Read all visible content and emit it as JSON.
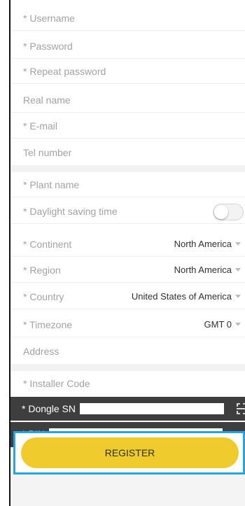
{
  "form": {
    "username": "* Username",
    "password": "* Password",
    "repeat_password": "* Repeat password",
    "real_name": "Real name",
    "email": "* E-mail",
    "tel_number": "Tel number",
    "plant_name": "* Plant name",
    "daylight_saving": "* Daylight saving time",
    "daylight_saving_on": false,
    "continent_label": "* Continent",
    "continent_value": "North America",
    "region_label": "* Region",
    "region_value": "North America",
    "country_label": "* Country",
    "country_value": "United States of America",
    "timezone_label": "* Timezone",
    "timezone_value": "GMT 0",
    "address": "Address",
    "installer_code": "* Installer Code",
    "dongle_sn_label": "* Dongle SN",
    "pin_label": "* PIN"
  },
  "actions": {
    "register_label": "REGISTER"
  },
  "colors": {
    "accent_yellow": "#efcb2d",
    "highlight_blue": "#2aa3dd",
    "dark_bar": "#3e3e3e"
  },
  "icons": {
    "scan": "scan-icon",
    "dropdown": "caret-down-icon"
  }
}
